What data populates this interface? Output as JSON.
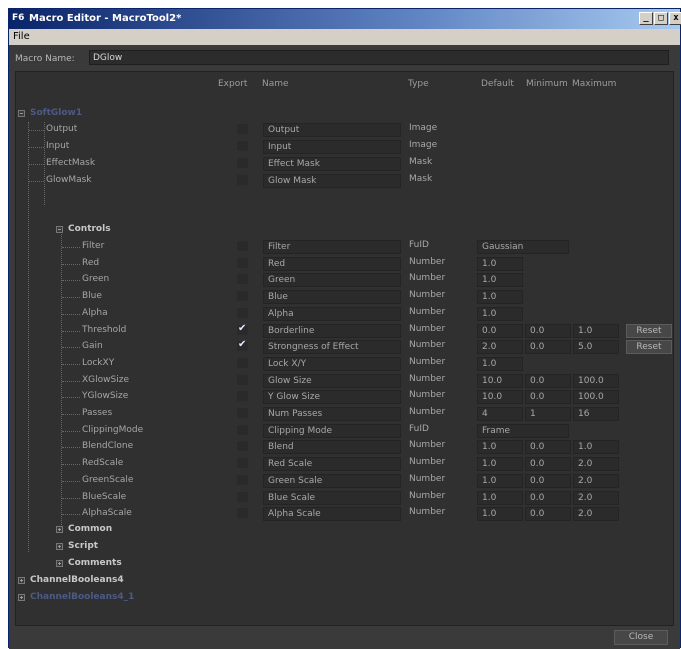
{
  "window": {
    "title": "Macro Editor - MacroTool2*",
    "app_icon_text": "F6"
  },
  "menu": {
    "file": "File"
  },
  "macro": {
    "label": "Macro Name:",
    "value": "DGlow"
  },
  "headers": {
    "export": "Export",
    "name": "Name",
    "type": "Type",
    "default": "Default",
    "minimum": "Minimum",
    "maximum": "Maximum"
  },
  "tree": {
    "softglow": "SoftGlow1",
    "controls": "Controls",
    "common": "Common",
    "script": "Script",
    "comments": "Comments",
    "channelbooleans4": "ChannelBooleans4",
    "channelbooleans4_1": "ChannelBooleans4_1"
  },
  "rows": [
    {
      "id": "Output",
      "export": false,
      "name": "Output",
      "type": "Image",
      "default": "",
      "min": "",
      "max": "",
      "reset": false
    },
    {
      "id": "Input",
      "export": false,
      "name": "Input",
      "type": "Image",
      "default": "",
      "min": "",
      "max": "",
      "reset": false
    },
    {
      "id": "EffectMask",
      "export": false,
      "name": "Effect Mask",
      "type": "Mask",
      "default": "",
      "min": "",
      "max": "",
      "reset": false
    },
    {
      "id": "GlowMask",
      "export": false,
      "name": "Glow Mask",
      "type": "Mask",
      "default": "",
      "min": "",
      "max": "",
      "reset": false
    },
    {
      "id": "Filter",
      "export": false,
      "name": "Filter",
      "type": "FuID",
      "default": "Gaussian",
      "min": "",
      "max": "",
      "reset": false
    },
    {
      "id": "Red",
      "export": false,
      "name": "Red",
      "type": "Number",
      "default": "1.0",
      "min": "",
      "max": "",
      "reset": false
    },
    {
      "id": "Green",
      "export": false,
      "name": "Green",
      "type": "Number",
      "default": "1.0",
      "min": "",
      "max": "",
      "reset": false
    },
    {
      "id": "Blue",
      "export": false,
      "name": "Blue",
      "type": "Number",
      "default": "1.0",
      "min": "",
      "max": "",
      "reset": false
    },
    {
      "id": "Alpha",
      "export": false,
      "name": "Alpha",
      "type": "Number",
      "default": "1.0",
      "min": "",
      "max": "",
      "reset": false
    },
    {
      "id": "Threshold",
      "export": true,
      "name": "Borderline",
      "type": "Number",
      "default": "0.0",
      "min": "0.0",
      "max": "1.0",
      "reset": true
    },
    {
      "id": "Gain",
      "export": true,
      "name": "Strongness of Effect",
      "type": "Number",
      "default": "2.0",
      "min": "0.0",
      "max": "5.0",
      "reset": true
    },
    {
      "id": "LockXY",
      "export": false,
      "name": "Lock X/Y",
      "type": "Number",
      "default": "1.0",
      "min": "",
      "max": "",
      "reset": false
    },
    {
      "id": "XGlowSize",
      "export": false,
      "name": "Glow Size",
      "type": "Number",
      "default": "10.0",
      "min": "0.0",
      "max": "100.0",
      "reset": false
    },
    {
      "id": "YGlowSize",
      "export": false,
      "name": "Y Glow Size",
      "type": "Number",
      "default": "10.0",
      "min": "0.0",
      "max": "100.0",
      "reset": false
    },
    {
      "id": "Passes",
      "export": false,
      "name": "Num Passes",
      "type": "Number",
      "default": "4",
      "min": "1",
      "max": "16",
      "reset": false
    },
    {
      "id": "ClippingMode",
      "export": false,
      "name": "Clipping Mode",
      "type": "FuID",
      "default": "Frame",
      "min": "",
      "max": "",
      "reset": false
    },
    {
      "id": "BlendClone",
      "export": false,
      "name": "Blend",
      "type": "Number",
      "default": "1.0",
      "min": "0.0",
      "max": "1.0",
      "reset": false
    },
    {
      "id": "RedScale",
      "export": false,
      "name": "Red Scale",
      "type": "Number",
      "default": "1.0",
      "min": "0.0",
      "max": "2.0",
      "reset": false
    },
    {
      "id": "GreenScale",
      "export": false,
      "name": "Green Scale",
      "type": "Number",
      "default": "1.0",
      "min": "0.0",
      "max": "2.0",
      "reset": false
    },
    {
      "id": "BlueScale",
      "export": false,
      "name": "Blue Scale",
      "type": "Number",
      "default": "1.0",
      "min": "0.0",
      "max": "2.0",
      "reset": false
    },
    {
      "id": "AlphaScale",
      "export": false,
      "name": "Alpha Scale",
      "type": "Number",
      "default": "1.0",
      "min": "0.0",
      "max": "2.0",
      "reset": false
    }
  ],
  "reset_label": "Reset",
  "close_label": "Close"
}
